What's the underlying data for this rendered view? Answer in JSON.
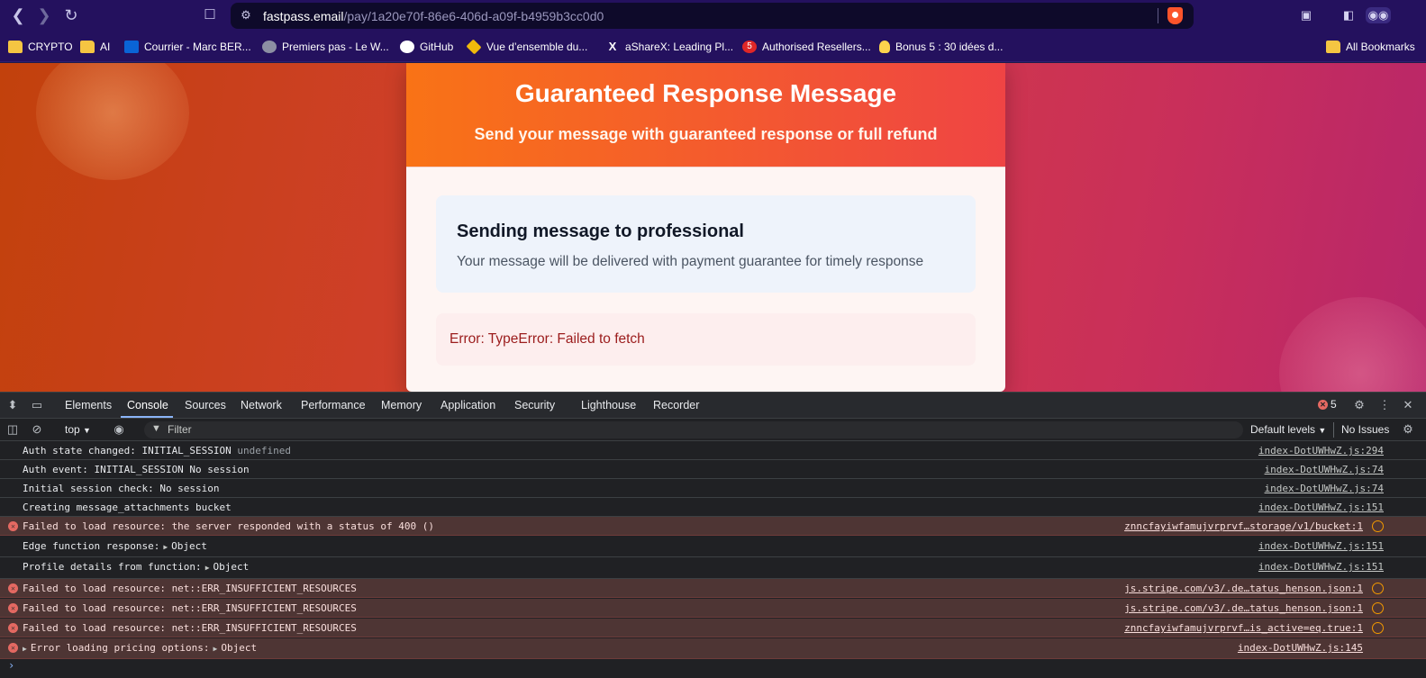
{
  "browser": {
    "url_host": "fastpass.email",
    "url_path": "/pay/1a20e70f-86e6-406d-a09f-b4959b3cc0d0",
    "icons": [
      "back-icon",
      "forward-icon",
      "reload-icon",
      "bookmark-icon",
      "site-settings-icon",
      "brave-shield-icon",
      "tab-search-icon",
      "sidebar-icon",
      "private-glasses-icon"
    ]
  },
  "bookmarks": {
    "items": [
      {
        "label": "CRYPTO",
        "icon": "folder-icon"
      },
      {
        "label": "AI",
        "icon": "folder-icon"
      },
      {
        "label": "Courrier - Marc BER...",
        "icon": "outlook-icon"
      },
      {
        "label": "Premiers pas - Le W...",
        "icon": "globe-icon"
      },
      {
        "label": "GitHub",
        "icon": "github-icon"
      },
      {
        "label": "Vue d’ensemble du...",
        "icon": "binance-icon"
      },
      {
        "label": "aShareX: Leading Pl...",
        "icon": "x-icon"
      },
      {
        "label": "Authorised Resellers...",
        "icon": "five-icon"
      },
      {
        "label": "Bonus 5 : 30 idées d...",
        "icon": "lightbulb-icon"
      }
    ],
    "all_label": "All Bookmarks"
  },
  "page": {
    "title": "Guaranteed Response Message",
    "subtitle": "Send your message with guaranteed response or full refund",
    "info_title": "Sending message to professional",
    "info_text": "Your message will be delivered with payment guarantee for timely response",
    "error_text": "Error: TypeError: Failed to fetch",
    "colors": {
      "header_start": "#f97316",
      "header_end": "#ef4444",
      "error": "#9b1c1c"
    }
  },
  "devtools": {
    "tabs": [
      "Elements",
      "Console",
      "Sources",
      "Network",
      "Performance",
      "Memory",
      "Application",
      "Security",
      "Lighthouse",
      "Recorder"
    ],
    "active_tab": "Console",
    "error_count": "5",
    "context": "top",
    "filter_placeholder": "Filter",
    "levels": "Default levels",
    "issues": "No Issues",
    "rows": [
      {
        "type": "log",
        "msg": "Auth state changed: INITIAL_SESSION",
        "extra": "undefined",
        "src": "index-DotUWHwZ.js:294"
      },
      {
        "type": "log",
        "msg": "Auth event: INITIAL_SESSION No session",
        "src": "index-DotUWHwZ.js:74"
      },
      {
        "type": "log",
        "msg": "Initial session check: No session",
        "src": "index-DotUWHwZ.js:74"
      },
      {
        "type": "log",
        "msg": "Creating message_attachments bucket",
        "src": "index-DotUWHwZ.js:151"
      },
      {
        "type": "error",
        "msg": "Failed to load resource: the server responded with a status of 400 ()",
        "src": "znncfayiwfamujvrprvf…storage/v1/bucket:1"
      },
      {
        "type": "log",
        "msg": "Edge function response:",
        "obj": "Object",
        "src": "index-DotUWHwZ.js:151"
      },
      {
        "type": "log",
        "msg": "Profile details from function:",
        "obj": "Object",
        "src": "index-DotUWHwZ.js:151"
      },
      {
        "type": "error",
        "msg": "Failed to load resource: net::ERR_INSUFFICIENT_RESOURCES",
        "src": "js.stripe.com/v3/.de…tatus_henson.json:1"
      },
      {
        "type": "error",
        "msg": "Failed to load resource: net::ERR_INSUFFICIENT_RESOURCES",
        "src": "js.stripe.com/v3/.de…tatus_henson.json:1"
      },
      {
        "type": "error",
        "msg": "Failed to load resource: net::ERR_INSUFFICIENT_RESOURCES",
        "src": "znncfayiwfamujvrprvf…is_active=eq.true:1"
      },
      {
        "type": "error",
        "msg": "Error loading pricing options:",
        "obj": "Object",
        "src": "index-DotUWHwZ.js:145"
      }
    ]
  }
}
